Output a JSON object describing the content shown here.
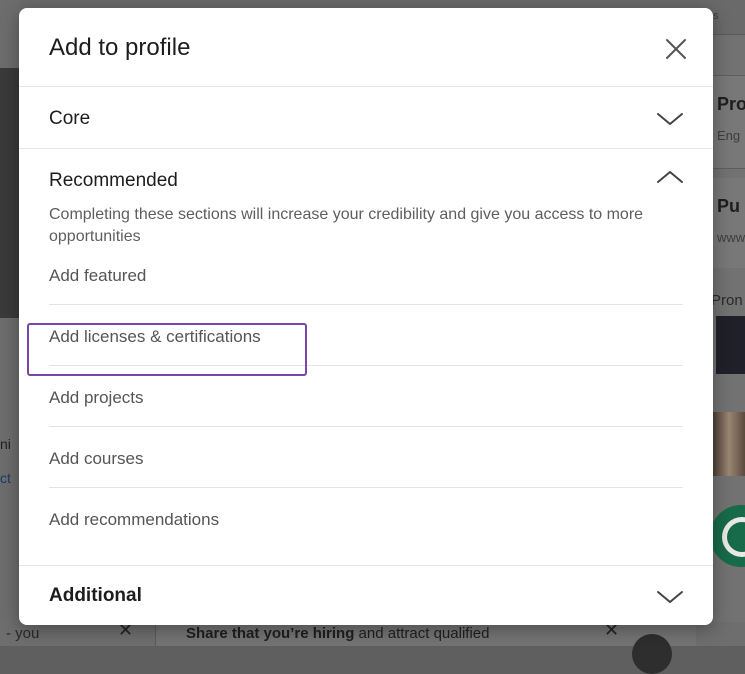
{
  "modal": {
    "title": "Add to profile",
    "close_icon": "close-icon"
  },
  "sections": {
    "core": {
      "label": "Core",
      "icon": "chevron-down-icon"
    },
    "recommended": {
      "label": "Recommended",
      "icon": "chevron-up-icon",
      "description": "Completing these sections will increase your credibility and give you access to more opportunities",
      "items": [
        {
          "label": "Add featured"
        },
        {
          "label": "Add licenses & certifications",
          "highlighted": true
        },
        {
          "label": "Add projects"
        },
        {
          "label": "Add courses"
        },
        {
          "label": "Add recommendations"
        }
      ]
    },
    "additional": {
      "label": "Additional",
      "icon": "chevron-down-icon"
    }
  },
  "background": {
    "right_card1_title": "Pro",
    "right_card1_sub": "Eng",
    "right_card2_title": "Pu",
    "right_card2_sub": "www",
    "right_card3_title": "Pron",
    "top_right_fragment": "s",
    "left_fragment1": "ni",
    "left_fragment2": "ct",
    "bottom_left_text": "- you",
    "bottom_card_bold": "Share that you’re hiring",
    "bottom_card_rest": " and attract qualified",
    "bottom_right_fragment": "P"
  },
  "colors": {
    "highlight": "#7b44a8",
    "overlay": "#6a6a6a"
  }
}
